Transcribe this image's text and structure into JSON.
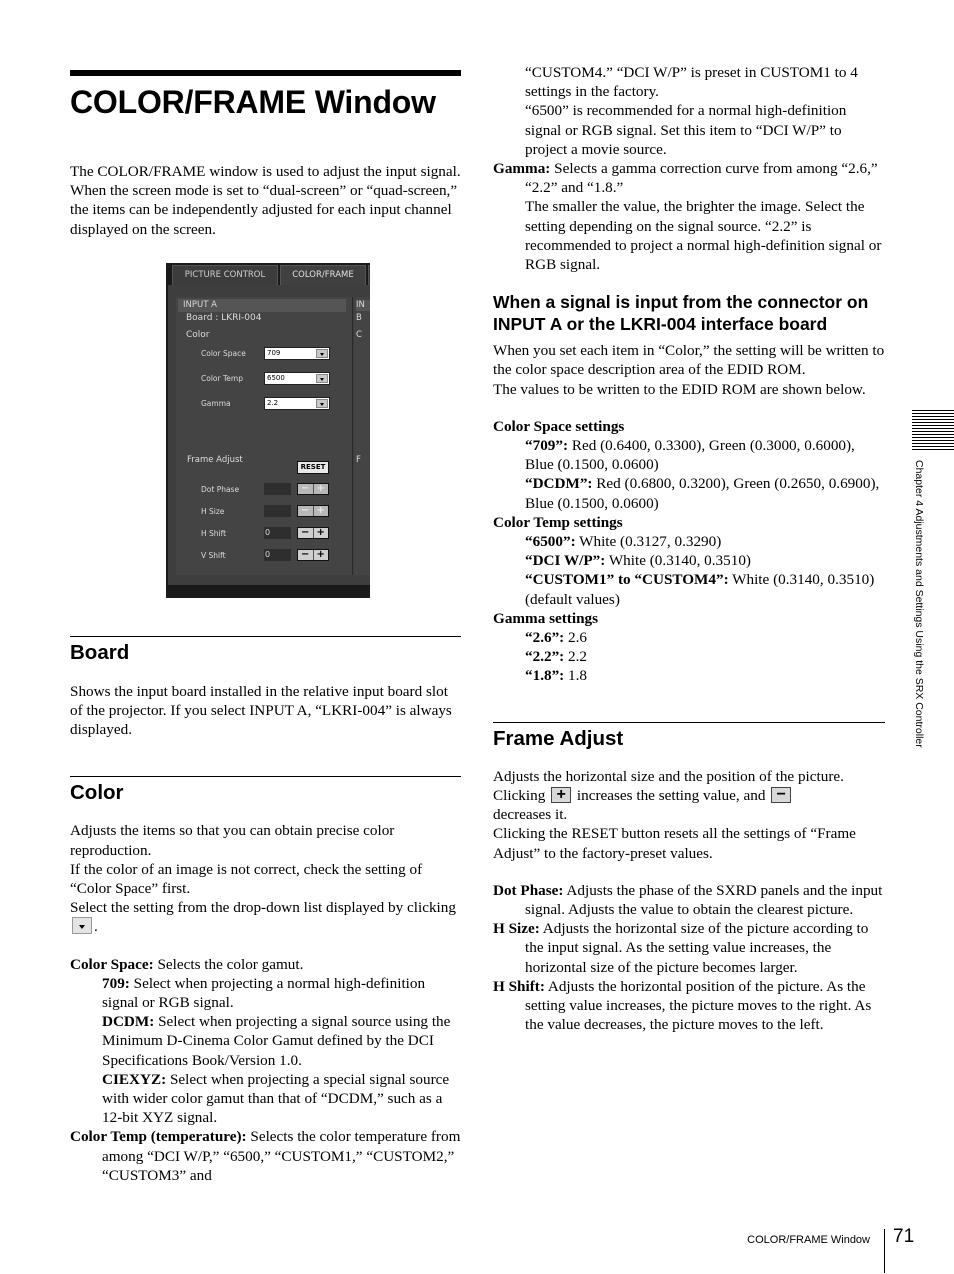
{
  "page": {
    "title": "COLOR/FRAME Window",
    "intro": [
      "The COLOR/FRAME window is used to adjust the input signal.",
      "When the screen mode is set to “dual-screen” or “quad-screen,” the items can be independently adjusted for each input channel displayed on the screen."
    ],
    "footer_label": "COLOR/FRAME Window",
    "page_number": "71",
    "side_tab": "Chapter 4  Adjustments and Settings Using the SRX Controller"
  },
  "screenshot": {
    "tabs": [
      {
        "label": "PICTURE CONTROL",
        "active": false
      },
      {
        "label": "COLOR/FRAME",
        "active": true
      }
    ],
    "panel_header": "INPUT A",
    "board_label": "Board : LKRI-004",
    "color_heading": "Color",
    "fields": [
      {
        "label": "Color Space",
        "value": "709"
      },
      {
        "label": "Color Temp",
        "value": "6500"
      },
      {
        "label": "Gamma",
        "value": "2.2"
      }
    ],
    "frame_heading": "Frame Adjust",
    "reset_label": "RESET",
    "adjusters": [
      {
        "label": "Dot Phase",
        "value": "",
        "enabled": false
      },
      {
        "label": "H Size",
        "value": "",
        "enabled": false
      },
      {
        "label": "H Shift",
        "value": "0",
        "enabled": true
      },
      {
        "label": "V Shift",
        "value": "0",
        "enabled": true
      }
    ],
    "minus_glyph": "−",
    "plus_glyph": "+",
    "next_panel_header": "IN",
    "next_panel_board": "B",
    "next_panel_color": "C",
    "next_panel_frame": "F"
  },
  "board": {
    "heading": "Board",
    "text": "Shows the input board installed in the relative input board slot of the projector. If you select INPUT A, “LKRI-004” is always displayed."
  },
  "color": {
    "heading": "Color",
    "p1": "Adjusts the items so that you can obtain precise color reproduction.",
    "p2": "If the color of an image is not correct, check the setting of “Color Space” first.",
    "p3_before": "Select the setting from the drop-down list displayed by clicking",
    "p3_after": ".",
    "color_space_term": "Color Space:",
    "color_space_desc": " Selects the color gamut.",
    "cs_items": [
      {
        "term": "709:",
        "desc": " Select when projecting a normal high-definition signal or RGB signal."
      },
      {
        "term": "DCDM:",
        "desc": " Select when projecting a signal source using the Minimum D-Cinema Color Gamut defined by the DCI Specifications Book/Version 1.0."
      },
      {
        "term": "CIEXYZ:",
        "desc": " Select when projecting a special signal source with wider color gamut than that of “DCDM,” such as a 12-bit XYZ signal."
      }
    ],
    "color_temp_term": "Color Temp (temperature):",
    "color_temp_desc": " Selects the color temperature from among “DCI W/P,” “6500,” “CUSTOM1,” “CUSTOM2,” “CUSTOM3” and",
    "color_temp_cont1": "“CUSTOM4.” “DCI W/P” is preset in CUSTOM1 to 4 settings in the factory.",
    "color_temp_cont2": "“6500” is recommended for a normal high-definition signal or RGB signal. Set this item to “DCI W/P” to project a movie source.",
    "gamma_term": "Gamma:",
    "gamma_desc": " Selects a gamma correction curve from among “2.6,” “2.2”  and “1.8.”",
    "gamma_cont": "The smaller the value, the brighter the image. Select the setting depending on the signal source. “2.2” is recommended to project a normal high-definition signal or RGB signal."
  },
  "edid": {
    "heading": "When a signal is input from the connector on INPUT A or the LKRI-004 interface board",
    "p1": "When you set each item in “Color,” the setting will be written to the color space description area of the EDID ROM.",
    "p2": "The values to be written to the EDID ROM are shown below.",
    "groups": [
      {
        "title": "Color Space settings",
        "items": [
          {
            "term": "“709”:",
            "desc": " Red (0.6400, 0.3300), Green (0.3000, 0.6000), Blue (0.1500, 0.0600)"
          },
          {
            "term": "“DCDM”:",
            "desc": " Red (0.6800, 0.3200), Green (0.2650, 0.6900), Blue (0.1500, 0.0600)"
          }
        ]
      },
      {
        "title": "Color Temp settings",
        "items": [
          {
            "term": "“6500”:",
            "desc": " White (0.3127, 0.3290)"
          },
          {
            "term": "“DCI W/P”:",
            "desc": " White (0.3140, 0.3510)"
          },
          {
            "term": "“CUSTOM1” to “CUSTOM4”:",
            "desc": " White (0.3140, 0.3510) (default values)"
          }
        ]
      },
      {
        "title": "Gamma settings",
        "items": [
          {
            "term": "“2.6”:",
            "desc": " 2.6"
          },
          {
            "term": "“2.2”:",
            "desc": " 2.2"
          },
          {
            "term": "“1.8”:",
            "desc": " 1.8"
          }
        ]
      }
    ]
  },
  "frame": {
    "heading": "Frame Adjust",
    "p1": "Adjusts the horizontal size and the position of the picture.",
    "p2_a": "Clicking",
    "p2_b": "increases the setting value, and",
    "p2_c": "decreases it.",
    "p3": "Clicking the RESET button resets all the settings of “Frame Adjust” to the factory-preset values.",
    "plus_glyph": "+",
    "minus_glyph": "−",
    "items": [
      {
        "term": "Dot Phase:",
        "desc": " Adjusts the phase of the SXRD panels and the input signal. Adjusts the value to obtain the clearest picture."
      },
      {
        "term": "H Size:",
        "desc": " Adjusts the horizontal size of the picture according to the input signal. As the setting value increases, the horizontal size of the picture becomes larger."
      },
      {
        "term": "H Shift:",
        "desc": " Adjusts the horizontal position of the picture. As the setting value increases, the picture moves to the right. As the value decreases, the picture moves to the left."
      }
    ]
  }
}
